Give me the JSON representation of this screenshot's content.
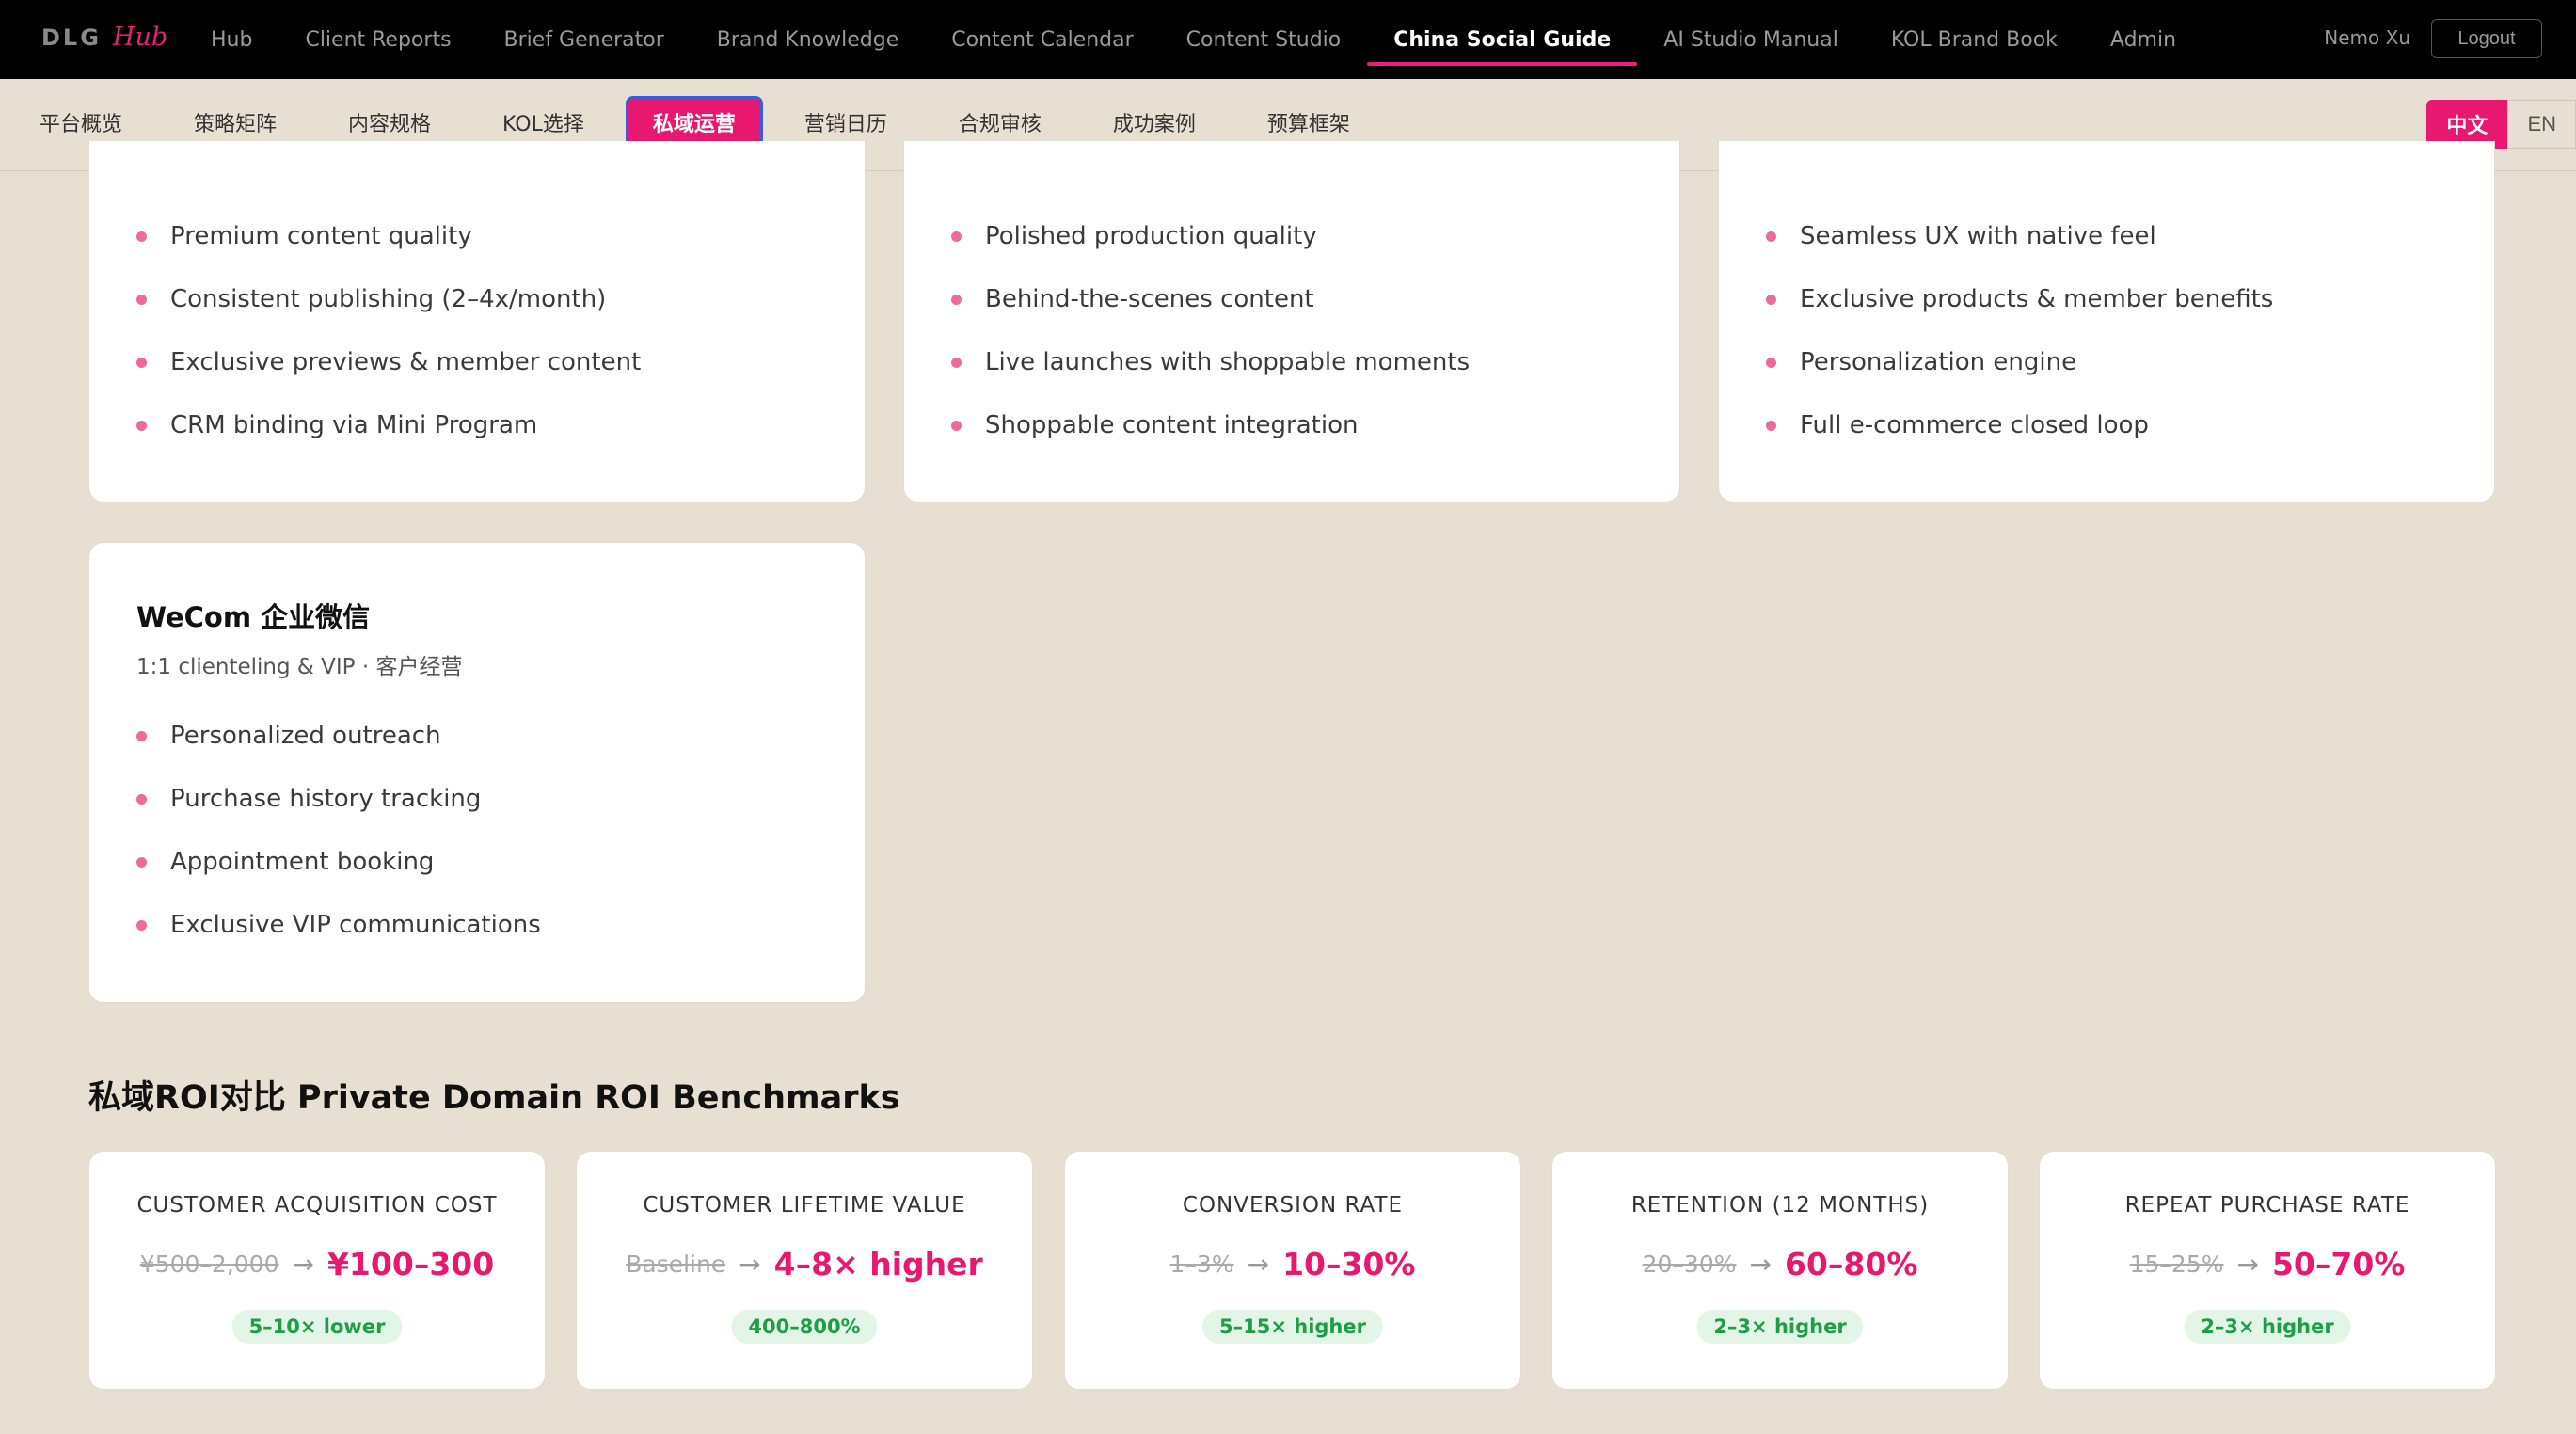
{
  "app": {
    "logo_main": "DLG",
    "logo_accent": "Hub"
  },
  "topnav": {
    "items": [
      "Hub",
      "Client Reports",
      "Brief Generator",
      "Brand Knowledge",
      "Content Calendar",
      "Content Studio",
      "China Social Guide",
      "AI Studio Manual",
      "KOL Brand Book",
      "Admin"
    ],
    "active": "China Social Guide",
    "user_name": "Nemo Xu",
    "logout_label": "Logout"
  },
  "subnav": {
    "tabs": [
      "平台概览",
      "策略矩阵",
      "内容规格",
      "KOL选择",
      "私域运营",
      "营销日历",
      "合规审核",
      "成功案例",
      "预算框架"
    ],
    "active": "私域运营",
    "lang_zh": "中文",
    "lang_en": "EN"
  },
  "cards_top": [
    {
      "items": [
        "Premium content quality",
        "Consistent publishing (2–4x/month)",
        "Exclusive previews & member content",
        "CRM binding via Mini Program"
      ]
    },
    {
      "items": [
        "Polished production quality",
        "Behind-the-scenes content",
        "Live launches with shoppable moments",
        "Shoppable content integration"
      ]
    },
    {
      "items": [
        "Seamless UX with native feel",
        "Exclusive products & member benefits",
        "Personalization engine",
        "Full e-commerce closed loop"
      ]
    }
  ],
  "wecom_card": {
    "title": "WeCom 企业微信",
    "subtitle": "1:1 clienteling & VIP · 客户经营",
    "items": [
      "Personalized outreach",
      "Purchase history tracking",
      "Appointment booking",
      "Exclusive VIP communications"
    ]
  },
  "roi_section": {
    "title": "私域ROI对比 Private Domain ROI Benchmarks",
    "cards": [
      {
        "label": "CUSTOMER ACQUISITION COST",
        "before": "¥500–2,000",
        "arrow": "→",
        "after": "¥100–300",
        "badge": "5–10× lower"
      },
      {
        "label": "CUSTOMER LIFETIME VALUE",
        "before": "Baseline",
        "arrow": "→",
        "after": "4–8× higher",
        "badge": "400–800%"
      },
      {
        "label": "CONVERSION RATE",
        "before": "1–3%",
        "arrow": "→",
        "after": "10–30%",
        "badge": "5–15× higher"
      },
      {
        "label": "RETENTION (12 MONTHS)",
        "before": "20–30%",
        "arrow": "→",
        "after": "60–80%",
        "badge": "2–3× higher"
      },
      {
        "label": "REPEAT PURCHASE RATE",
        "before": "15–25%",
        "arrow": "→",
        "after": "50–70%",
        "badge": "2–3× higher"
      }
    ]
  },
  "colors": {
    "accent": "#e8176f",
    "background": "#e8dfd3",
    "badge_green": "#1f9d47"
  }
}
